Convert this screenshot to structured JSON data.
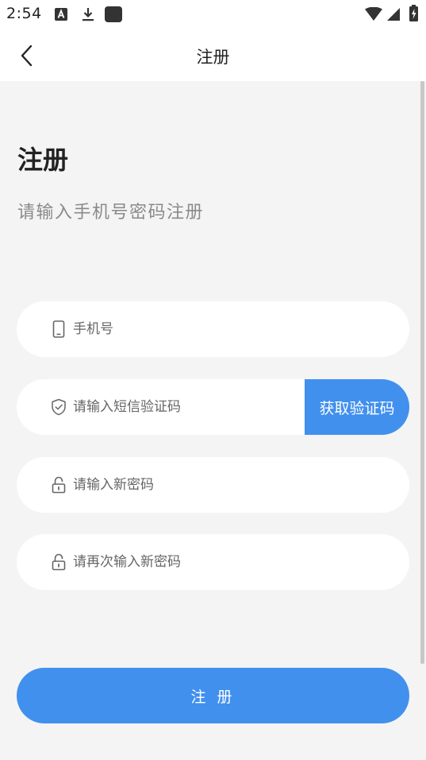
{
  "status_bar": {
    "time": "2:54"
  },
  "app_bar": {
    "title": "注册"
  },
  "heading": {
    "title": "注册",
    "subtitle": "请输入手机号密码注册"
  },
  "form": {
    "phone_placeholder": "手机号",
    "sms_code_placeholder": "请输入短信验证码",
    "get_code_label": "获取验证码",
    "new_password_placeholder": "请输入新密码",
    "confirm_password_placeholder": "请再次输入新密码"
  },
  "submit_label": "注 册",
  "colors": {
    "accent": "#4190ee",
    "background": "#f4f4f4",
    "field_background": "#ffffff"
  }
}
